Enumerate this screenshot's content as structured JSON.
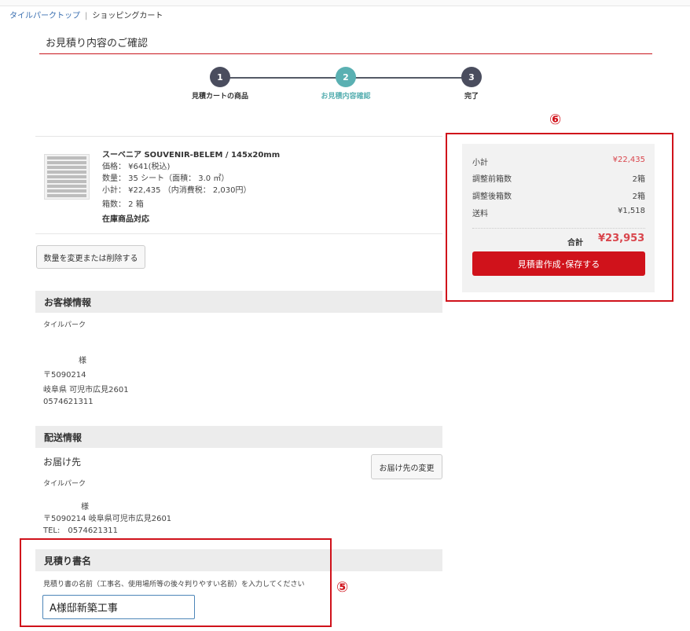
{
  "breadcrumb": {
    "home": "タイルパークトップ",
    "separator": "|",
    "current": "ショッピングカート"
  },
  "page_title": "お見積り内容のご確認",
  "steps": [
    {
      "num": "1",
      "label": "見積カートの商品",
      "state": "done",
      "color": "#4a4d5e"
    },
    {
      "num": "2",
      "label": "お見積内容確認",
      "state": "active",
      "color": "#5ab0b2"
    },
    {
      "num": "3",
      "label": "完了",
      "state": "todo",
      "color": "#4a4d5e"
    }
  ],
  "product": {
    "name": "スーベニア SOUVENIR-BELEM / 145x20mm",
    "price": "価格： ¥641(税込)",
    "quantity": "数量： 35 シート（面積： 3.0 ㎡）",
    "subtotal": "小計： ¥22,435 （内消費税： 2,030円）",
    "boxes": "箱数： 2 箱",
    "stock": "在庫商品対応"
  },
  "change_qty_button": "数量を変更または削除する",
  "customer": {
    "heading": "お客様情報",
    "company": "タイルパーク",
    "honorific": "様",
    "postal": "〒5090214",
    "address": "岐阜県 可児市広見2601",
    "phone": "0574621311"
  },
  "shipping": {
    "heading": "配送情報",
    "dest_title": "お届け先",
    "change_button": "お届け先の変更",
    "company": "タイルパーク",
    "honorific": "様",
    "address_line": "〒5090214 岐阜県可児市広見2601",
    "phone": "TEL:　0574621311"
  },
  "estimate_name": {
    "heading": "見積り書名",
    "instruction": "見積り書の名前（工事名、使用場所等の後々判りやすい名前）を入力してください",
    "value": "A様邸新築工事"
  },
  "summary": {
    "rows": [
      {
        "label": "小計",
        "value": "¥22,435",
        "color": "#d9454c"
      },
      {
        "label": "調整前箱数",
        "value": "2箱",
        "color": "#444444"
      },
      {
        "label": "調整後箱数",
        "value": "2箱",
        "color": "#444444"
      },
      {
        "label": "送料",
        "value": "¥1,518",
        "color": "#444444"
      }
    ],
    "total_label": "合計",
    "total_value": "¥23,953",
    "save_button": "見積書作成･保存する"
  },
  "annotations": {
    "marker_5": "⑤",
    "marker_6": "⑥"
  },
  "colors": {
    "accent_red": "#d0121b",
    "teal": "#5ab0b2",
    "step_dark": "#4a4d5e"
  }
}
